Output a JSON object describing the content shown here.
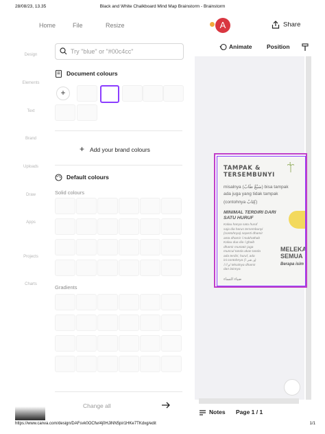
{
  "print_header": {
    "datetime": "28/08/23, 13.35",
    "doc_title": "Black and White Chalkboard Mind Map Brainstorm - Brainstorm"
  },
  "print_footer": {
    "url": "https://www.canva.com/design/DAFsvk0OCfw/4j0HJiNN5pir1HKe7TKdxg/edit",
    "page": "1/1"
  },
  "topbar": {
    "nav": [
      "Home",
      "File",
      "Resize"
    ],
    "avatar_letter": "A",
    "share_label": "Share"
  },
  "sidebar": {
    "items": [
      "Design",
      "Elements",
      "Text",
      "Brand",
      "Uploads",
      "Draw",
      "Apps",
      "Projects",
      "Charts"
    ]
  },
  "panel": {
    "search_placeholder": "Try \"blue\" or \"#00c4cc\"",
    "document_colours_title": "Document colours",
    "add_brand_label": "Add your brand colours",
    "default_colours_title": "Default colours",
    "solid_colours_label": "Solid colours",
    "gradients_label": "Gradients",
    "change_all_label": "Change all"
  },
  "right_toolbar": {
    "animate_label": "Animate",
    "position_label": "Position"
  },
  "design_page": {
    "heading1": "TAMPAK &",
    "heading2": "TERSEMBUNYI",
    "line1": "misalnya (سَبْعٌ طَابٌ) bisa tampak",
    "line2": "ada juga yang tidak tampak",
    "line3": "(contohnya كِتَابٌ)",
    "subheading1": "MINIMAL TERDIRI DARI",
    "subheading2": "SATU HURUF",
    "body_lines": [
      "Kalau hanya satu huruf",
      "saja dia harus tersembunyi",
      "(contohnya) seperti dhamir",
      "anta dhamir ﺍ mukhathab",
      "Kalau dua dia ﺍ ghaib",
      "dhamir mustatir juga",
      "muncul tanda akan tanda",
      "ada terdiri, huruf, ada",
      "ini contohnya (ﻭ, ﻫﻢ, ﺍ)",
      "ﻭ ﺍ/ ﺍ/ Misalnya dhamir",
      "dan lainnya"
    ],
    "melek1": "MELEKA",
    "melek2": "SEMUA",
    "berapa": "Berapa isim",
    "footer_text": "ضياء النساء"
  },
  "bottom_bar": {
    "notes_label": "Notes",
    "page_label": "Page 1 / 1"
  },
  "colors": {
    "accent": "#8b3dff",
    "avatar": "#d93640",
    "selection": "#c03ec8"
  }
}
